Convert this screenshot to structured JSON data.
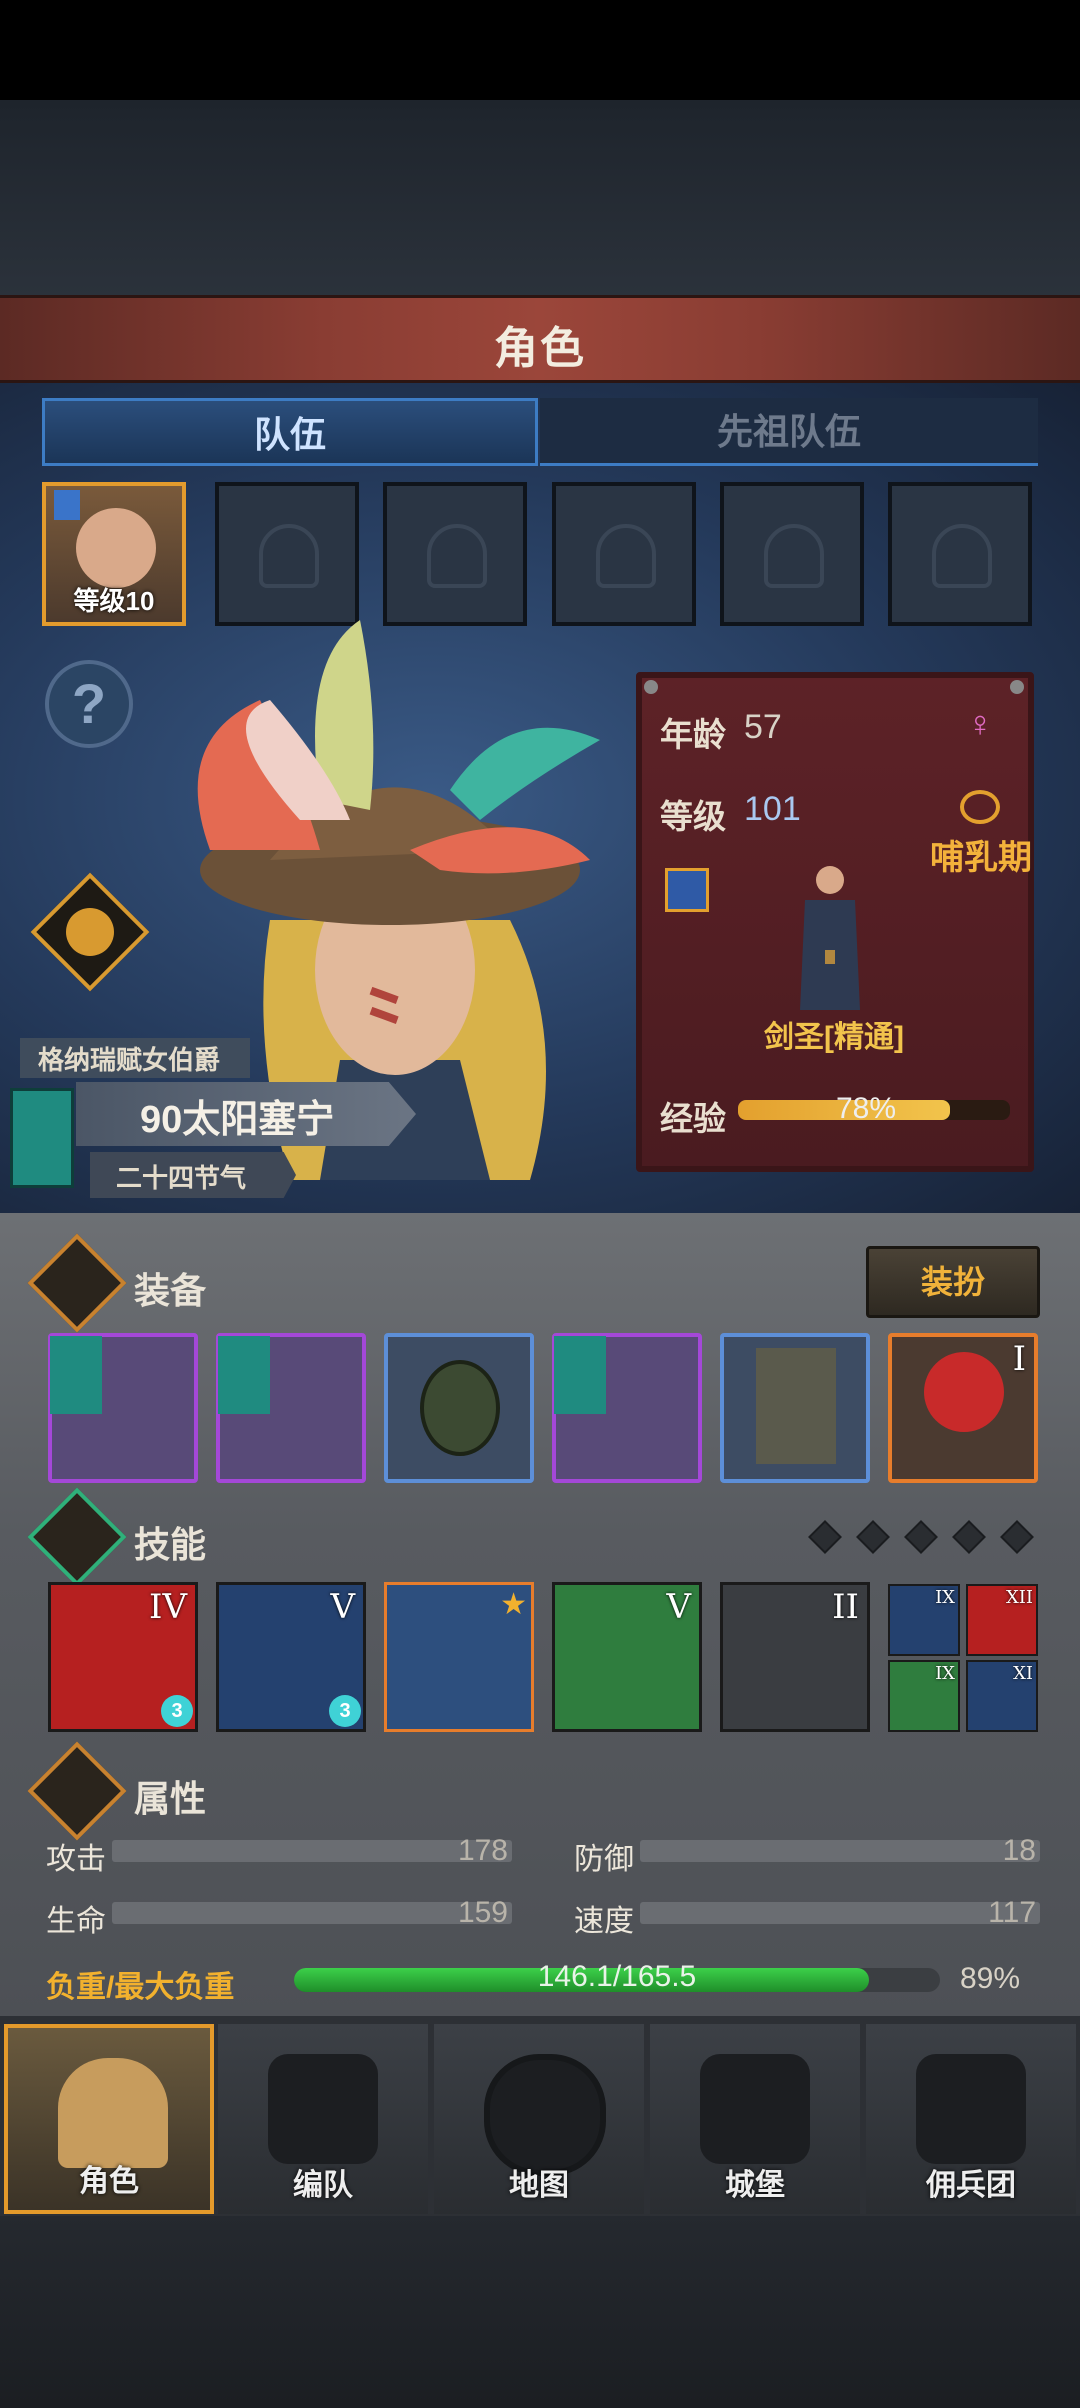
{
  "title": "角色",
  "tabs": [
    {
      "label": "队伍",
      "active": true
    },
    {
      "label": "先祖队伍",
      "active": false
    }
  ],
  "party": {
    "slot1_level": "等级10"
  },
  "hero": {
    "title_label": "格纳瑞赋女伯爵",
    "name": "90太阳塞宁",
    "subtitle": "二十四节气",
    "age_label": "年龄",
    "age": "57",
    "level_label": "等级",
    "level": "101",
    "stage": "哺乳期",
    "class": "剑圣[精通]",
    "exp_label": "经验",
    "exp_percent": "78%",
    "exp_fraction": 0.78
  },
  "equipment": {
    "section": "装备",
    "dress_button": "装扮",
    "trinket_rank": "I"
  },
  "skills": {
    "section": "技能",
    "ranks": [
      "IV",
      "V",
      "",
      "V",
      "II"
    ],
    "ranks_small": [
      "IX",
      "XII",
      "IX",
      "XI"
    ],
    "badge": "3"
  },
  "attributes": {
    "section": "属性",
    "attack_label": "攻击",
    "attack": "178",
    "defense_label": "防御",
    "defense": "18",
    "health_label": "生命",
    "health": "159",
    "speed_label": "速度",
    "speed": "117",
    "load_label": "负重/最大负重",
    "load": "146.1/165.5",
    "load_percent": "89%",
    "load_fraction": 0.89
  },
  "nav": [
    "角色",
    "编队",
    "地图",
    "城堡",
    "佣兵团"
  ],
  "colors": {
    "accent": "#e39b2d",
    "tab_blue": "#3d7cc4",
    "card_red": "#5d2227",
    "bar_green": "#2fae3a"
  }
}
